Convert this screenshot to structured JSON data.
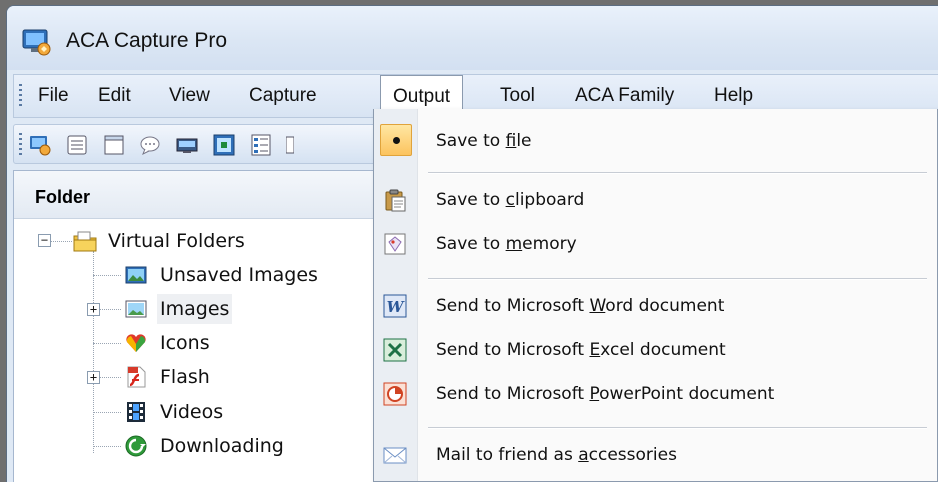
{
  "window": {
    "title": "ACA Capture Pro",
    "title_icon": "app-logo-icon"
  },
  "menubar": {
    "items": [
      {
        "label": "File",
        "open": false
      },
      {
        "label": "Edit",
        "open": false
      },
      {
        "label": "View",
        "open": false
      },
      {
        "label": "Capture",
        "open": false
      },
      {
        "label": "Output",
        "open": true
      },
      {
        "label": "Tool",
        "open": false
      },
      {
        "label": "ACA Family",
        "open": false
      },
      {
        "label": "Help",
        "open": false
      }
    ]
  },
  "toolbar": {
    "icons": [
      "app-capture-icon",
      "window-capture-icon",
      "blank-page-icon",
      "speech-bubble-icon",
      "monitor-icon",
      "region-capture-icon",
      "list-capture-icon",
      "more-icon"
    ]
  },
  "folder_pane": {
    "header": "Folder",
    "tree": [
      {
        "label": "Virtual Folders",
        "icon": "virtual-folders-icon",
        "expander": "−",
        "selected": false
      },
      {
        "label": "Unsaved Images",
        "icon": "unsaved-images-icon",
        "expander": null,
        "selected": false
      },
      {
        "label": "Images",
        "icon": "images-icon",
        "expander": "+",
        "selected": true
      },
      {
        "label": "Icons",
        "icon": "heart-icons-icon",
        "expander": null,
        "selected": false
      },
      {
        "label": "Flash",
        "icon": "flash-icon",
        "expander": "+",
        "selected": false
      },
      {
        "label": "Videos",
        "icon": "film-icon",
        "expander": null,
        "selected": false
      },
      {
        "label": "Downloading",
        "icon": "download-icon",
        "expander": null,
        "selected": false
      }
    ]
  },
  "output_menu": {
    "items": [
      {
        "pre": "Save to ",
        "accel": "f",
        "post": "ile",
        "icon": "radio-dot-icon",
        "checked": true
      },
      {
        "pre": "Save to ",
        "accel": "c",
        "post": "lipboard",
        "icon": "clipboard-icon",
        "checked": false
      },
      {
        "pre": "Save to ",
        "accel": "m",
        "post": "emory",
        "icon": "memory-icon",
        "checked": false
      },
      {
        "pre": "Send to Microsoft ",
        "accel": "W",
        "post": "ord document",
        "icon": "word-icon",
        "checked": false
      },
      {
        "pre": "Send to Microsoft ",
        "accel": "E",
        "post": "xcel document",
        "icon": "excel-icon",
        "checked": false
      },
      {
        "pre": "Send to Microsoft ",
        "accel": "P",
        "post": "owerPoint document",
        "icon": "powerpoint-icon",
        "checked": false
      },
      {
        "pre": "Mail to friend as ",
        "accel": "a",
        "post": "ccessories",
        "icon": "envelope-icon",
        "checked": false
      }
    ]
  },
  "colors": {
    "menu_highlight": "#fcc35e",
    "window_frame": "#dfe9f5",
    "word_blue": "#2b5797",
    "excel_green": "#1e7145",
    "powerpoint_orange": "#d04423"
  }
}
